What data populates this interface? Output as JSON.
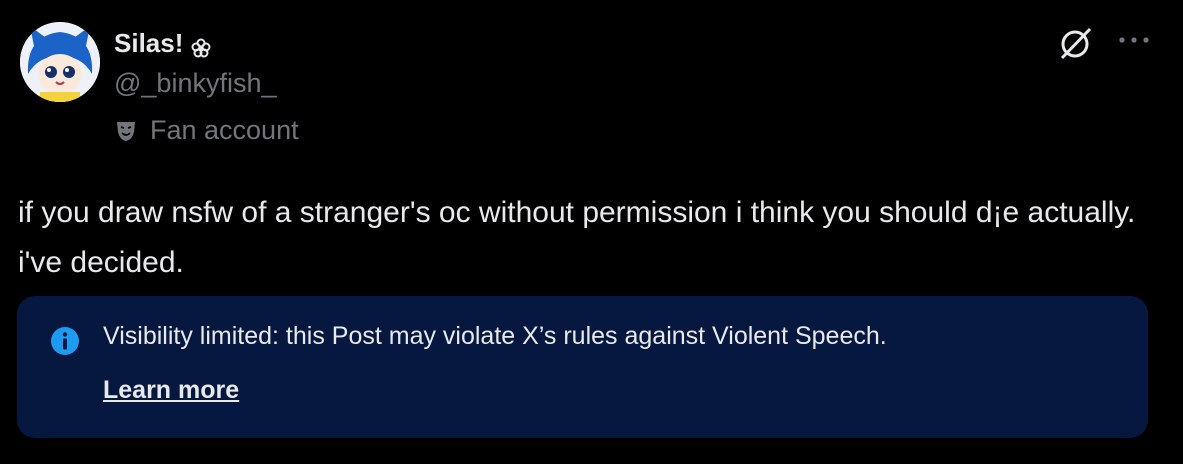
{
  "author": {
    "display_name": "Silas!",
    "handle": "@_binkyfish_",
    "label": "Fan account",
    "label_icon": "theater-mask-icon",
    "name_badge_icon": "flower-icon"
  },
  "header_actions": {
    "grok_icon": "slashed-circle-icon",
    "more_icon": "more-dots-icon"
  },
  "post": {
    "text": "if you draw nsfw of a stranger's oc without permission i think you should d¡e actually. i've decided."
  },
  "notice": {
    "icon": "info-icon",
    "text": "Visibility limited: this Post may violate X’s rules against Violent Speech.",
    "link_label": "Learn more"
  },
  "colors": {
    "background": "#000000",
    "primary_text": "#e7e9ea",
    "secondary_text": "#71767b",
    "notice_bg": "#061740",
    "info_blue": "#1d9bf0"
  }
}
